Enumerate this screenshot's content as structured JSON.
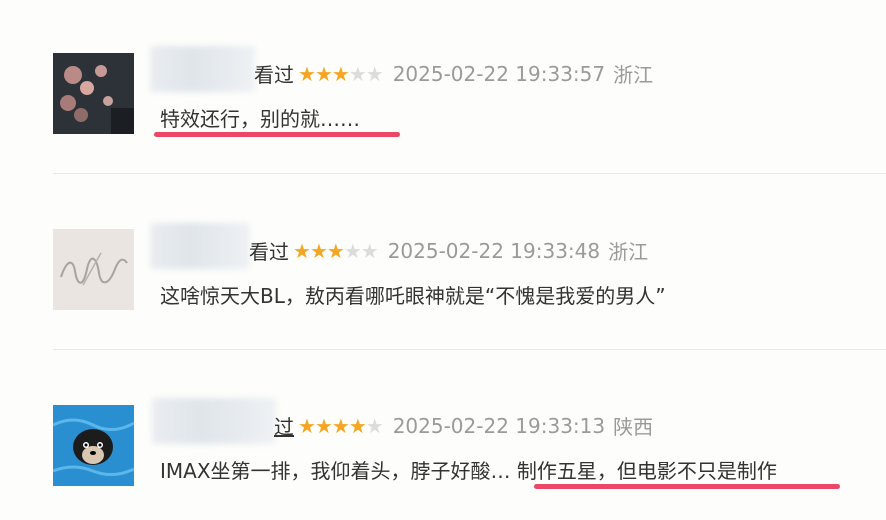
{
  "comments": [
    {
      "watched_label": "看过",
      "rating": 3,
      "time": "2025-02-22 19:33:57",
      "location": "浙江",
      "text": "特效还行，别的就……"
    },
    {
      "watched_label": "看过",
      "rating": 3,
      "time": "2025-02-22 19:33:48",
      "location": "浙江",
      "text": "这啥惊天大BL，敖丙看哪吒眼神就是“不愧是我爱的男人”"
    },
    {
      "watched_label": "过",
      "rating": 4,
      "time": "2025-02-22 19:33:13",
      "location": "陕西",
      "text_part1": "IMAX坐第一排，我仰着头，脖子好酸…",
      "text_part2": "制作五星，但电影不只是制作"
    }
  ],
  "colors": {
    "star_on": "#f5a623",
    "star_off": "#dcdcdc",
    "annotation_underline": "#ec4766"
  }
}
